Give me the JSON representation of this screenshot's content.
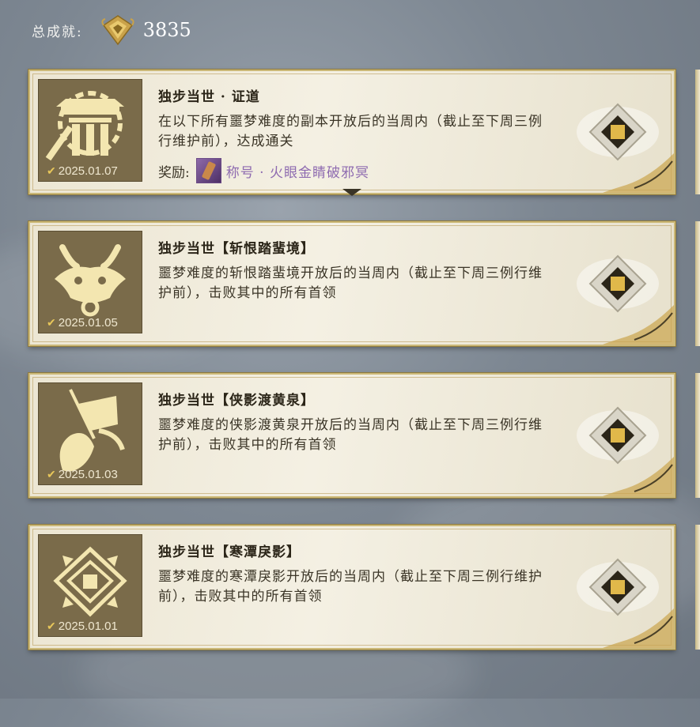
{
  "header": {
    "label": "总成就:",
    "total": "3835",
    "medal_icon": "gold-medal-icon"
  },
  "cards": [
    {
      "title": "独步当世 · 证道",
      "description": "在以下所有噩梦难度的副本开放后的当周内（截止至下周三例行维护前），达成通关",
      "reward_label": "奖励:",
      "reward_name": "称号 · 火眼金睛破邪冥",
      "date": "2025.01.07",
      "icon": "pavilion-sun-icon",
      "expanded_arrow": true
    },
    {
      "title": "独步当世【斩恨踏蜚境】",
      "description": "噩梦难度的斩恨踏蜚境开放后的当周内（截止至下周三例行维护前），击败其中的所有首领",
      "date": "2025.01.05",
      "icon": "dragon-head-icon"
    },
    {
      "title": "独步当世【侠影渡黄泉】",
      "description": "噩梦难度的侠影渡黄泉开放后的当周内（截止至下周三例行维护前），击败其中的所有首领",
      "date": "2025.01.03",
      "icon": "flag-beast-icon"
    },
    {
      "title": "独步当世【寒潭戾影】",
      "description": "噩梦难度的寒潭戾影开放后的当周内（截止至下周三例行维护前），击败其中的所有首领",
      "date": "2025.01.01",
      "icon": "diamond-rune-icon"
    }
  ],
  "colors": {
    "card_bg": "#f0ebdb",
    "gold": "#cbb877",
    "icon_bg": "#7a6b4a",
    "reward_purple": "#8e6bb0"
  }
}
